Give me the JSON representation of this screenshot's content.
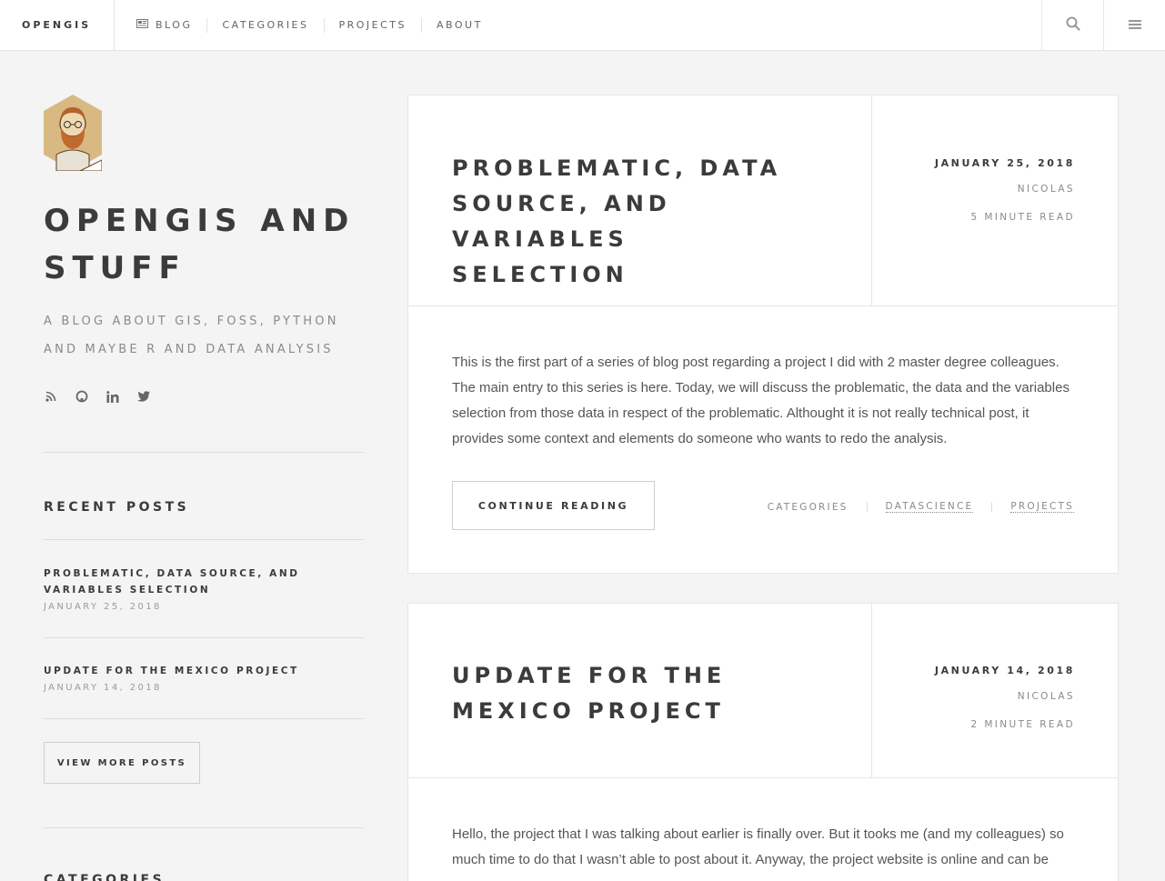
{
  "nav": {
    "brand": "OPENGIS",
    "links": [
      {
        "label": "BLOG",
        "icon": "newspaper-icon"
      },
      {
        "label": "CATEGORIES"
      },
      {
        "label": "PROJECTS"
      },
      {
        "label": "ABOUT"
      }
    ],
    "search_icon": "search-icon",
    "menu_icon": "hamburger-menu-icon"
  },
  "sidebar": {
    "title_line1": "OPENGIS AND",
    "title_line2": "STUFF",
    "subtitle_line1": "A BLOG ABOUT GIS, FOSS, PYTHON",
    "subtitle_line2": "AND MAYBE R AND DATA ANALYSIS",
    "socials": [
      "rss-icon",
      "github-icon",
      "linkedin-icon",
      "twitter-icon"
    ],
    "recent_heading": "RECENT POSTS",
    "recent": [
      {
        "title_line1": "PROBLEMATIC, DATA SOURCE, AND",
        "title_line2": "VARIABLES SELECTION",
        "date": "JANUARY 25, 2018"
      },
      {
        "title_line1": "UPDATE FOR THE MEXICO PROJECT",
        "title_line2": "",
        "date": "JANUARY 14, 2018"
      }
    ],
    "view_more": "VIEW MORE POSTS",
    "categories_heading": "CATEGORIES"
  },
  "posts": [
    {
      "title_lines": [
        "PROBLEMATIC, DATA",
        "SOURCE, AND",
        "VARIABLES SELECTION"
      ],
      "date": "JANUARY 25, 2018",
      "author": "NICOLAS",
      "read_time": "5 MINUTE READ",
      "excerpt_lines": [
        "This is the first part of a series of blog post regarding a project I did with 2 master degree colleagues.",
        "The main entry to this series is here. Today, we will discuss the problematic, the data and the variables",
        "selection from those data in respect of the problematic. Althought it is not really technical post, it",
        "provides some context and elements do someone who wants to redo the analysis."
      ],
      "continue": "CONTINUE READING",
      "tags_label": "CATEGORIES",
      "tags": [
        "DATASCIENCE",
        "PROJECTS"
      ]
    },
    {
      "title_lines": [
        "UPDATE FOR THE",
        "MEXICO PROJECT"
      ],
      "date": "JANUARY 14, 2018",
      "author": "NICOLAS",
      "read_time": "2 MINUTE READ",
      "excerpt_lines": [
        "Hello, the project that I was talking about earlier is finally over. But it tooks me (and my colleagues) so",
        "much time to do that I wasn’t able to post about it. Anyway, the project website is online and can be"
      ]
    }
  ],
  "colors": {
    "background": "#f4f4f4",
    "card": "#ffffff",
    "text": "#3c3b3b",
    "muted": "#8a8a8a"
  }
}
